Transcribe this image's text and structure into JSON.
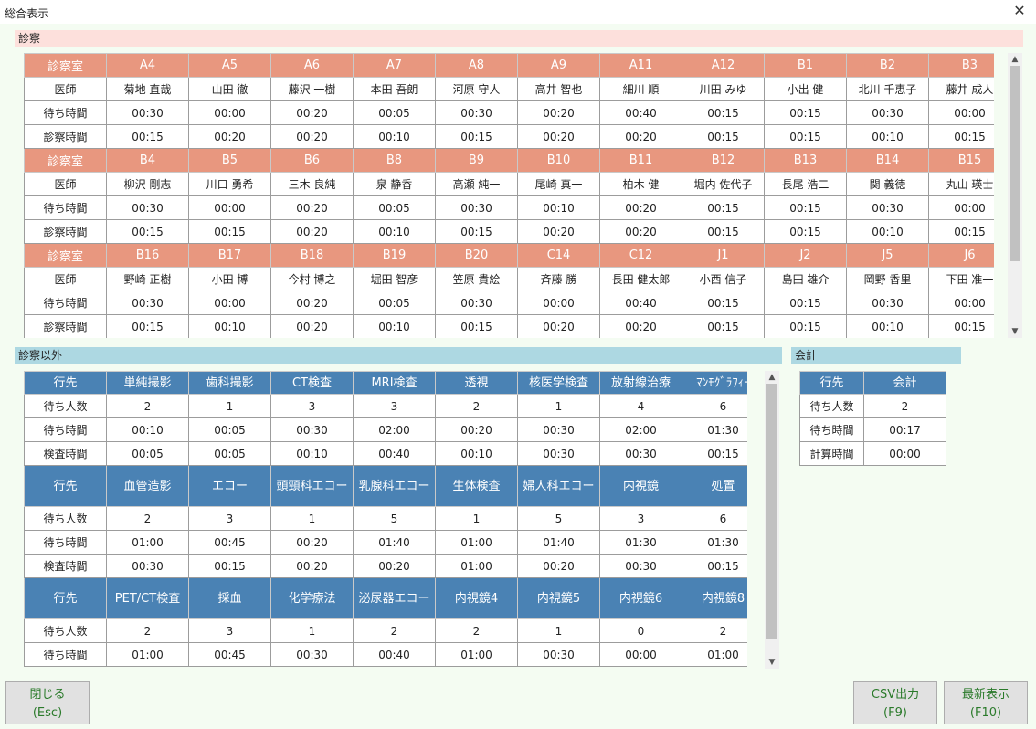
{
  "window": {
    "title": "総合表示"
  },
  "sections": {
    "shinsatsu": "診察",
    "other": "診察以外",
    "kaikei": "会計"
  },
  "shinsatsu_blocks": [
    {
      "header": "診察室",
      "rooms": [
        "A4",
        "A5",
        "A6",
        "A7",
        "A8",
        "A9",
        "A11",
        "A12",
        "B1",
        "B2",
        "B3"
      ],
      "rows": [
        {
          "label": "医師",
          "cells": [
            "菊地 直哉",
            "山田 徹",
            "藤沢 一樹",
            "本田 吾朗",
            "河原 守人",
            "高井 智也",
            "細川 順",
            "川田 みゆ",
            "小出 健",
            "北川 千恵子",
            "藤井 成人"
          ]
        },
        {
          "label": "待ち時間",
          "cells": [
            "00:30",
            "00:00",
            "00:20",
            "00:05",
            "00:30",
            "00:20",
            "00:40",
            "00:15",
            "00:15",
            "00:30",
            "00:00"
          ]
        },
        {
          "label": "診察時間",
          "cells": [
            "00:15",
            "00:20",
            "00:20",
            "00:10",
            "00:15",
            "00:20",
            "00:20",
            "00:15",
            "00:15",
            "00:10",
            "00:15"
          ]
        }
      ]
    },
    {
      "header": "診察室",
      "rooms": [
        "B4",
        "B5",
        "B6",
        "B8",
        "B9",
        "B10",
        "B11",
        "B12",
        "B13",
        "B14",
        "B15"
      ],
      "rows": [
        {
          "label": "医師",
          "cells": [
            "柳沢 剛志",
            "川口 勇希",
            "三木 良純",
            "泉 静香",
            "高瀬 純一",
            "尾崎 真一",
            "柏木 健",
            "堀内 佐代子",
            "長尾 浩二",
            "関 義徳",
            "丸山 瑛士"
          ]
        },
        {
          "label": "待ち時間",
          "cells": [
            "00:30",
            "00:00",
            "00:20",
            "00:05",
            "00:30",
            "00:10",
            "00:20",
            "00:15",
            "00:15",
            "00:30",
            "00:00"
          ]
        },
        {
          "label": "診察時間",
          "cells": [
            "00:15",
            "00:15",
            "00:20",
            "00:10",
            "00:15",
            "00:20",
            "00:20",
            "00:15",
            "00:15",
            "00:10",
            "00:15"
          ]
        }
      ]
    },
    {
      "header": "診察室",
      "rooms": [
        "B16",
        "B17",
        "B18",
        "B19",
        "B20",
        "C14",
        "C12",
        "J1",
        "J2",
        "J5",
        "J6"
      ],
      "rows": [
        {
          "label": "医師",
          "cells": [
            "野崎 正樹",
            "小田 博",
            "今村 博之",
            "堀田 智彦",
            "笠原 貴絵",
            "斉藤 勝",
            "長田 健太郎",
            "小西 信子",
            "島田 雄介",
            "岡野 香里",
            "下田 准一"
          ]
        },
        {
          "label": "待ち時間",
          "cells": [
            "00:30",
            "00:00",
            "00:20",
            "00:05",
            "00:30",
            "00:00",
            "00:40",
            "00:15",
            "00:15",
            "00:30",
            "00:00"
          ]
        },
        {
          "label": "診察時間",
          "cells": [
            "00:15",
            "00:10",
            "00:20",
            "00:10",
            "00:15",
            "00:20",
            "00:20",
            "00:15",
            "00:15",
            "00:10",
            "00:15"
          ]
        }
      ]
    }
  ],
  "other_blocks": [
    {
      "header": "行先",
      "dests": [
        "単純撮影",
        "歯科撮影",
        "CT検査",
        "MRI検査",
        "透視",
        "核医学検査",
        "放射線治療",
        "ﾏﾝﾓｸﾞﾗﾌｨｰ"
      ],
      "rows": [
        {
          "label": "待ち人数",
          "cells": [
            "2",
            "1",
            "3",
            "3",
            "2",
            "1",
            "4",
            "6"
          ]
        },
        {
          "label": "待ち時間",
          "cells": [
            "00:10",
            "00:05",
            "00:30",
            "02:00",
            "00:20",
            "00:30",
            "02:00",
            "01:30"
          ]
        },
        {
          "label": "検査時間",
          "cells": [
            "00:05",
            "00:05",
            "00:10",
            "00:40",
            "00:10",
            "00:30",
            "00:30",
            "00:15"
          ]
        }
      ]
    },
    {
      "header": "行先",
      "dests": [
        "血管造影",
        "エコー",
        "頭頸科エコー",
        "乳腺科エコー",
        "生体検査",
        "婦人科エコー",
        "内視鏡",
        "処置"
      ],
      "rows": [
        {
          "label": "待ち人数",
          "cells": [
            "2",
            "3",
            "1",
            "5",
            "1",
            "5",
            "3",
            "6"
          ]
        },
        {
          "label": "待ち時間",
          "cells": [
            "01:00",
            "00:45",
            "00:20",
            "01:40",
            "01:00",
            "01:40",
            "01:30",
            "01:30"
          ]
        },
        {
          "label": "検査時間",
          "cells": [
            "00:30",
            "00:15",
            "00:20",
            "00:20",
            "01:00",
            "00:20",
            "00:30",
            "00:15"
          ]
        }
      ]
    },
    {
      "header": "行先",
      "dests": [
        "PET/CT検査",
        "採血",
        "化学療法",
        "泌尿器エコー",
        "内視鏡4",
        "内視鏡5",
        "内視鏡6",
        "内視鏡8"
      ],
      "rows": [
        {
          "label": "待ち人数",
          "cells": [
            "2",
            "3",
            "1",
            "2",
            "2",
            "1",
            "0",
            "2"
          ]
        },
        {
          "label": "待ち時間",
          "cells": [
            "01:00",
            "00:45",
            "00:30",
            "00:40",
            "01:00",
            "00:30",
            "00:00",
            "01:00"
          ]
        }
      ]
    }
  ],
  "kaikei": {
    "header": "行先",
    "dest": "会計",
    "rows": [
      {
        "label": "待ち人数",
        "value": "2"
      },
      {
        "label": "待ち時間",
        "value": "00:17"
      },
      {
        "label": "計算時間",
        "value": "00:00"
      }
    ]
  },
  "buttons": {
    "close": {
      "label": "閉じる",
      "key": "(Esc)"
    },
    "csv": {
      "label": "CSV出力",
      "key": "(F9)"
    },
    "refresh": {
      "label": "最新表示",
      "key": "(F10)"
    }
  }
}
